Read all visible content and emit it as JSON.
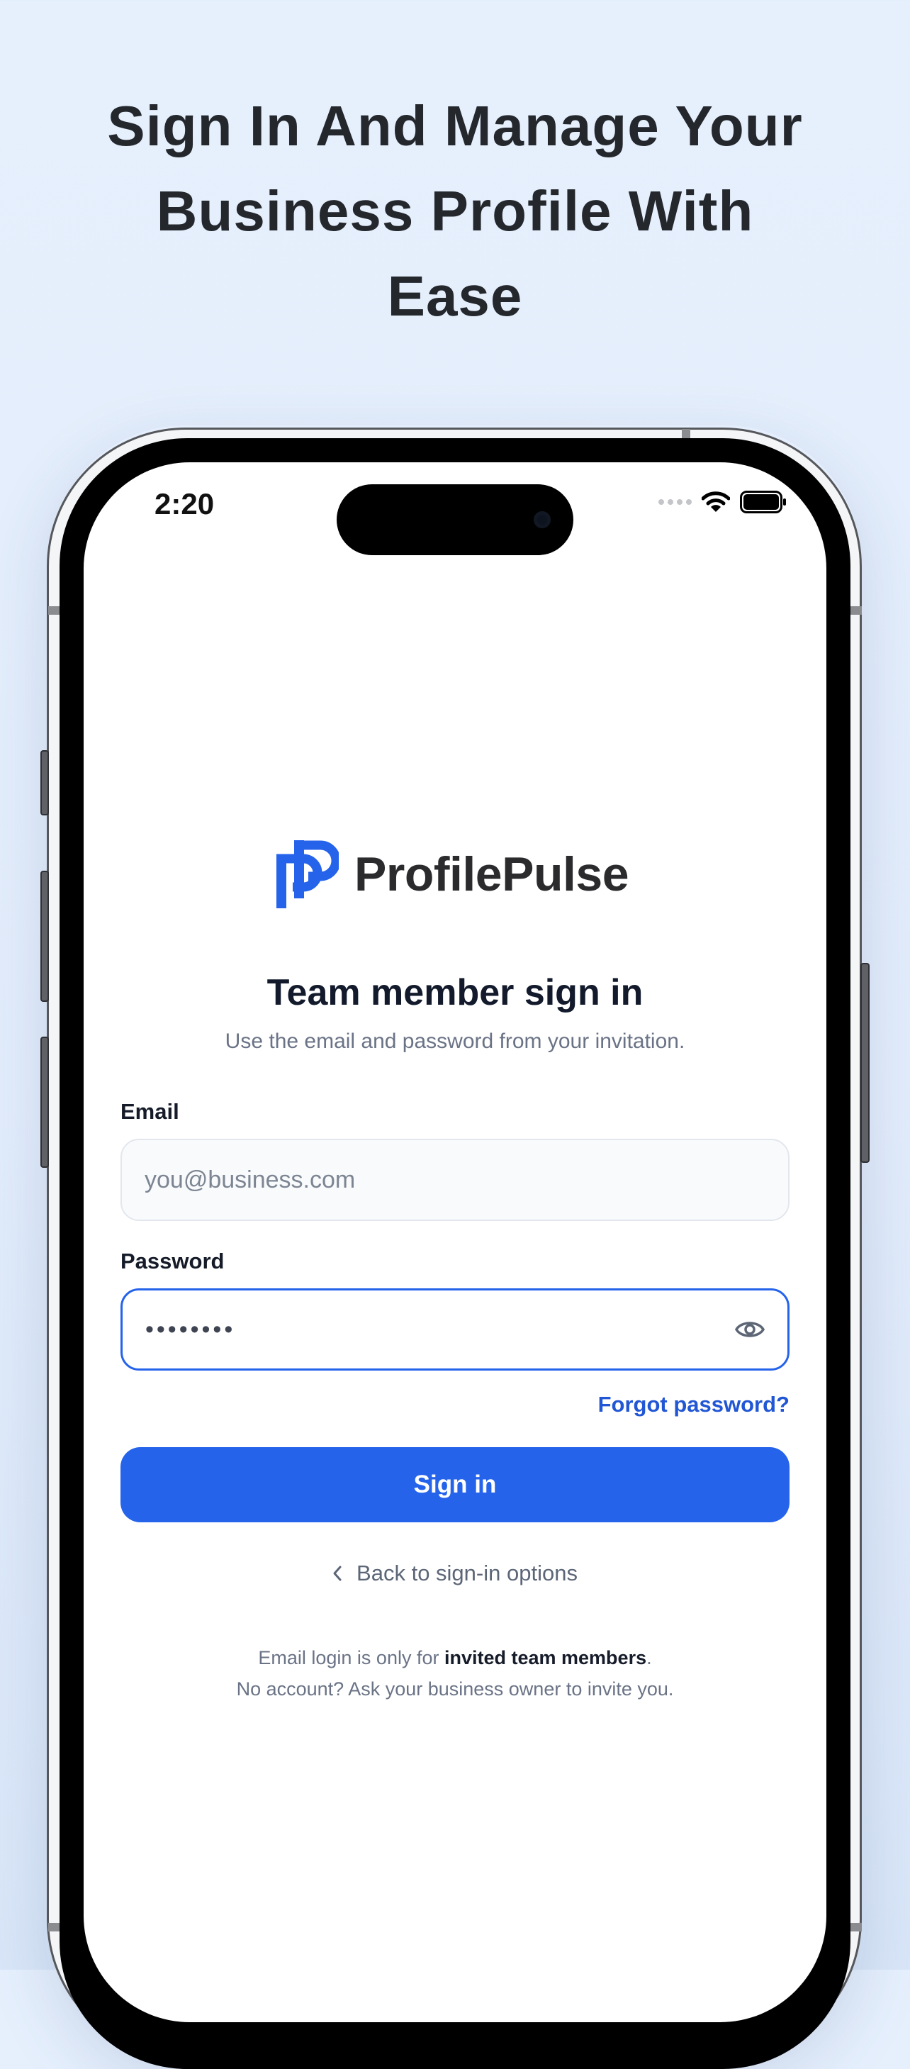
{
  "headline": {
    "line1": "Sign In And Manage Your",
    "line2": "Business Profile With",
    "line3": "Ease"
  },
  "status_bar": {
    "time": "2:20"
  },
  "brand": {
    "name": "ProfilePulse",
    "accent_color": "#2563eb"
  },
  "form": {
    "title": "Team member sign in",
    "subtitle": "Use the email and password from your invitation.",
    "email": {
      "label": "Email",
      "placeholder": "you@business.com",
      "value": ""
    },
    "password": {
      "label": "Password",
      "value": "••••••••",
      "toggle_icon": "eye-icon"
    },
    "forgot_label": "Forgot password?",
    "submit_label": "Sign in",
    "back_label": "Back to sign-in options",
    "back_icon": "chevron-left-icon"
  },
  "footer": {
    "line1_prefix": "Email login is only for ",
    "line1_bold": "invited team members",
    "line1_suffix": ".",
    "line2": "No account? Ask your business owner to invite you."
  }
}
